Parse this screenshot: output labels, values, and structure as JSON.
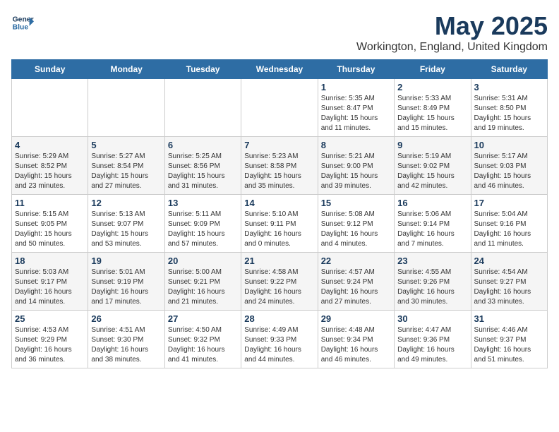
{
  "logo": {
    "line1": "General",
    "line2": "Blue"
  },
  "title": "May 2025",
  "subtitle": "Workington, England, United Kingdom",
  "weekdays": [
    "Sunday",
    "Monday",
    "Tuesday",
    "Wednesday",
    "Thursday",
    "Friday",
    "Saturday"
  ],
  "weeks": [
    [
      {
        "day": "",
        "info": ""
      },
      {
        "day": "",
        "info": ""
      },
      {
        "day": "",
        "info": ""
      },
      {
        "day": "",
        "info": ""
      },
      {
        "day": "1",
        "info": "Sunrise: 5:35 AM\nSunset: 8:47 PM\nDaylight: 15 hours\nand 11 minutes."
      },
      {
        "day": "2",
        "info": "Sunrise: 5:33 AM\nSunset: 8:49 PM\nDaylight: 15 hours\nand 15 minutes."
      },
      {
        "day": "3",
        "info": "Sunrise: 5:31 AM\nSunset: 8:50 PM\nDaylight: 15 hours\nand 19 minutes."
      }
    ],
    [
      {
        "day": "4",
        "info": "Sunrise: 5:29 AM\nSunset: 8:52 PM\nDaylight: 15 hours\nand 23 minutes."
      },
      {
        "day": "5",
        "info": "Sunrise: 5:27 AM\nSunset: 8:54 PM\nDaylight: 15 hours\nand 27 minutes."
      },
      {
        "day": "6",
        "info": "Sunrise: 5:25 AM\nSunset: 8:56 PM\nDaylight: 15 hours\nand 31 minutes."
      },
      {
        "day": "7",
        "info": "Sunrise: 5:23 AM\nSunset: 8:58 PM\nDaylight: 15 hours\nand 35 minutes."
      },
      {
        "day": "8",
        "info": "Sunrise: 5:21 AM\nSunset: 9:00 PM\nDaylight: 15 hours\nand 39 minutes."
      },
      {
        "day": "9",
        "info": "Sunrise: 5:19 AM\nSunset: 9:02 PM\nDaylight: 15 hours\nand 42 minutes."
      },
      {
        "day": "10",
        "info": "Sunrise: 5:17 AM\nSunset: 9:03 PM\nDaylight: 15 hours\nand 46 minutes."
      }
    ],
    [
      {
        "day": "11",
        "info": "Sunrise: 5:15 AM\nSunset: 9:05 PM\nDaylight: 15 hours\nand 50 minutes."
      },
      {
        "day": "12",
        "info": "Sunrise: 5:13 AM\nSunset: 9:07 PM\nDaylight: 15 hours\nand 53 minutes."
      },
      {
        "day": "13",
        "info": "Sunrise: 5:11 AM\nSunset: 9:09 PM\nDaylight: 15 hours\nand 57 minutes."
      },
      {
        "day": "14",
        "info": "Sunrise: 5:10 AM\nSunset: 9:11 PM\nDaylight: 16 hours\nand 0 minutes."
      },
      {
        "day": "15",
        "info": "Sunrise: 5:08 AM\nSunset: 9:12 PM\nDaylight: 16 hours\nand 4 minutes."
      },
      {
        "day": "16",
        "info": "Sunrise: 5:06 AM\nSunset: 9:14 PM\nDaylight: 16 hours\nand 7 minutes."
      },
      {
        "day": "17",
        "info": "Sunrise: 5:04 AM\nSunset: 9:16 PM\nDaylight: 16 hours\nand 11 minutes."
      }
    ],
    [
      {
        "day": "18",
        "info": "Sunrise: 5:03 AM\nSunset: 9:17 PM\nDaylight: 16 hours\nand 14 minutes."
      },
      {
        "day": "19",
        "info": "Sunrise: 5:01 AM\nSunset: 9:19 PM\nDaylight: 16 hours\nand 17 minutes."
      },
      {
        "day": "20",
        "info": "Sunrise: 5:00 AM\nSunset: 9:21 PM\nDaylight: 16 hours\nand 21 minutes."
      },
      {
        "day": "21",
        "info": "Sunrise: 4:58 AM\nSunset: 9:22 PM\nDaylight: 16 hours\nand 24 minutes."
      },
      {
        "day": "22",
        "info": "Sunrise: 4:57 AM\nSunset: 9:24 PM\nDaylight: 16 hours\nand 27 minutes."
      },
      {
        "day": "23",
        "info": "Sunrise: 4:55 AM\nSunset: 9:26 PM\nDaylight: 16 hours\nand 30 minutes."
      },
      {
        "day": "24",
        "info": "Sunrise: 4:54 AM\nSunset: 9:27 PM\nDaylight: 16 hours\nand 33 minutes."
      }
    ],
    [
      {
        "day": "25",
        "info": "Sunrise: 4:53 AM\nSunset: 9:29 PM\nDaylight: 16 hours\nand 36 minutes."
      },
      {
        "day": "26",
        "info": "Sunrise: 4:51 AM\nSunset: 9:30 PM\nDaylight: 16 hours\nand 38 minutes."
      },
      {
        "day": "27",
        "info": "Sunrise: 4:50 AM\nSunset: 9:32 PM\nDaylight: 16 hours\nand 41 minutes."
      },
      {
        "day": "28",
        "info": "Sunrise: 4:49 AM\nSunset: 9:33 PM\nDaylight: 16 hours\nand 44 minutes."
      },
      {
        "day": "29",
        "info": "Sunrise: 4:48 AM\nSunset: 9:34 PM\nDaylight: 16 hours\nand 46 minutes."
      },
      {
        "day": "30",
        "info": "Sunrise: 4:47 AM\nSunset: 9:36 PM\nDaylight: 16 hours\nand 49 minutes."
      },
      {
        "day": "31",
        "info": "Sunrise: 4:46 AM\nSunset: 9:37 PM\nDaylight: 16 hours\nand 51 minutes."
      }
    ]
  ]
}
